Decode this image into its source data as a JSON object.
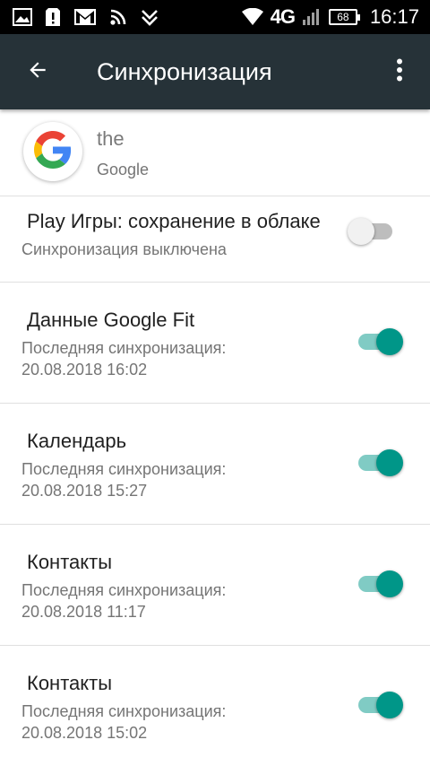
{
  "status_bar": {
    "network": "4G",
    "battery": "68",
    "time": "16:17",
    "icons": [
      "gallery-icon",
      "sim-alert-icon",
      "gmail-icon",
      "rss-icon",
      "download-icon",
      "wifi-icon",
      "signal-icon",
      "battery-icon"
    ]
  },
  "app_bar": {
    "title": "Синхронизация",
    "back_icon": "arrow-back-icon",
    "menu_icon": "more-vert-icon"
  },
  "account": {
    "name": "the",
    "type": "Google"
  },
  "sync_items": [
    {
      "title": "Play Игры: сохранение в облаке",
      "subtitle": "Синхронизация выключена",
      "enabled": false
    },
    {
      "title": "Данные Google Fit",
      "subtitle_label": "Последняя синхронизация:",
      "subtitle_time": "20.08.2018 16:02",
      "enabled": true
    },
    {
      "title": "Календарь",
      "subtitle_label": "Последняя синхронизация:",
      "subtitle_time": "20.08.2018 15:27",
      "enabled": true
    },
    {
      "title": "Контакты",
      "subtitle_label": "Последняя синхронизация:",
      "subtitle_time": "20.08.2018 11:17",
      "enabled": true
    },
    {
      "title": "Контакты",
      "subtitle_label": "Последняя синхронизация:",
      "subtitle_time": "20.08.2018 15:02",
      "enabled": true
    }
  ],
  "colors": {
    "app_bar": "#263238",
    "switch_on": "#009688",
    "switch_on_track": "#80cbc4",
    "switch_off_track": "#bdbdbd"
  }
}
